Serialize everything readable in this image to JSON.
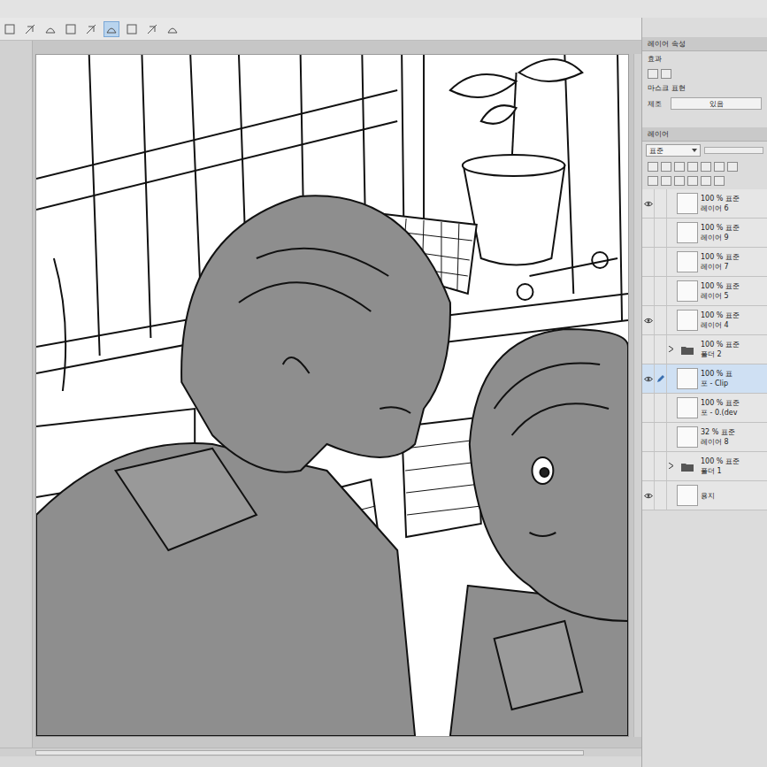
{
  "toolbar": {
    "tools": [
      {
        "selected": false
      },
      {
        "selected": false
      },
      {
        "selected": false
      },
      {
        "selected": false
      },
      {
        "selected": false
      },
      {
        "selected": true
      },
      {
        "selected": false
      },
      {
        "selected": false
      },
      {
        "selected": false
      }
    ]
  },
  "property_panel": {
    "tab": "레이어 속성",
    "section": "효과",
    "mask_label": "마스크 표현",
    "field_label": "제조",
    "field_value": "있음"
  },
  "layer_panel": {
    "tab": "레이어",
    "blend_mode": "표준",
    "layers": [
      {
        "mode": "100 % 표준",
        "name": "레이어 6",
        "visible": true,
        "selected": false,
        "editing": false,
        "kind": "layer"
      },
      {
        "mode": "100 % 표준",
        "name": "레이어 9",
        "visible": false,
        "selected": false,
        "editing": false,
        "kind": "layer"
      },
      {
        "mode": "100 % 표준",
        "name": "레이어 7",
        "visible": false,
        "selected": false,
        "editing": false,
        "kind": "layer"
      },
      {
        "mode": "100 % 표준",
        "name": "레이어 5",
        "visible": false,
        "selected": false,
        "editing": false,
        "kind": "layer"
      },
      {
        "mode": "100 % 표준",
        "name": "레이어 4",
        "visible": true,
        "selected": false,
        "editing": false,
        "kind": "layer"
      },
      {
        "mode": "100 % 표준",
        "name": "폴더 2",
        "visible": false,
        "selected": false,
        "editing": false,
        "kind": "folder"
      },
      {
        "mode": "100 % 표",
        "name": "포 - Clip",
        "visible": true,
        "selected": true,
        "editing": true,
        "kind": "layer"
      },
      {
        "mode": "100 % 표준",
        "name": "포 - 0.(dev",
        "visible": false,
        "selected": false,
        "editing": false,
        "kind": "layer"
      },
      {
        "mode": "32 % 표준",
        "name": "레이어 8",
        "visible": false,
        "selected": false,
        "editing": false,
        "kind": "layer"
      },
      {
        "mode": "100 % 표준",
        "name": "폴더 1",
        "visible": false,
        "selected": false,
        "editing": false,
        "kind": "folder"
      },
      {
        "mode": "",
        "name": "용지",
        "visible": true,
        "selected": false,
        "editing": false,
        "kind": "paper"
      }
    ]
  }
}
